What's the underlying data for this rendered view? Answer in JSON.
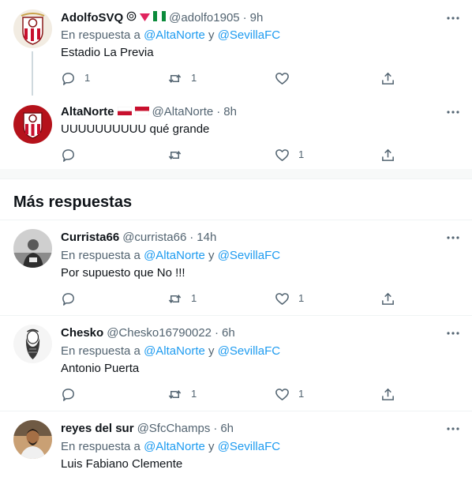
{
  "thread": [
    {
      "name": "AdolfoSVQ",
      "handle": "@adolfo1905",
      "time": "9h",
      "reply_prefix": "En respuesta a",
      "mention1": "@AltaNorte",
      "conj": "y",
      "mention2": "@SevillaFC",
      "text": "Estadio La Previa",
      "reply_count": "1",
      "retweet_count": "1",
      "like_count": ""
    },
    {
      "name": "AltaNorte",
      "handle": "@AltaNorte",
      "time": "8h",
      "text": "UUUUUUUUUU qué grande",
      "reply_count": "",
      "retweet_count": "",
      "like_count": "1"
    }
  ],
  "section": {
    "title": "Más respuestas"
  },
  "replies": [
    {
      "name": "Currista66",
      "handle": "@currista66",
      "time": "14h",
      "reply_prefix": "En respuesta a",
      "mention1": "@AltaNorte",
      "conj": "y",
      "mention2": "@SevillaFC",
      "text": "Por supuesto que No !!!",
      "reply_count": "",
      "retweet_count": "1",
      "like_count": "1"
    },
    {
      "name": "Chesko",
      "handle": "@Chesko16790022",
      "time": "6h",
      "reply_prefix": "En respuesta a",
      "mention1": "@AltaNorte",
      "conj": "y",
      "mention2": "@SevillaFC",
      "text": "Antonio Puerta",
      "reply_count": "",
      "retweet_count": "1",
      "like_count": "1"
    },
    {
      "name": "reyes del sur",
      "handle": "@SfcChamps",
      "time": "6h",
      "reply_prefix": "En respuesta a",
      "mention1": "@AltaNorte",
      "conj": "y",
      "mention2": "@SevillaFC",
      "text": "Luis Fabiano Clemente"
    }
  ],
  "colors": {
    "text_primary": "#0f1419",
    "text_secondary": "#536471",
    "link": "#1d9bf0",
    "divider": "#eff3f4",
    "sevilla_red": "#c8102e"
  },
  "icons": {
    "reply": "reply-icon",
    "retweet": "retweet-icon",
    "like": "like-icon",
    "share": "share-icon",
    "more": "more-icon"
  }
}
